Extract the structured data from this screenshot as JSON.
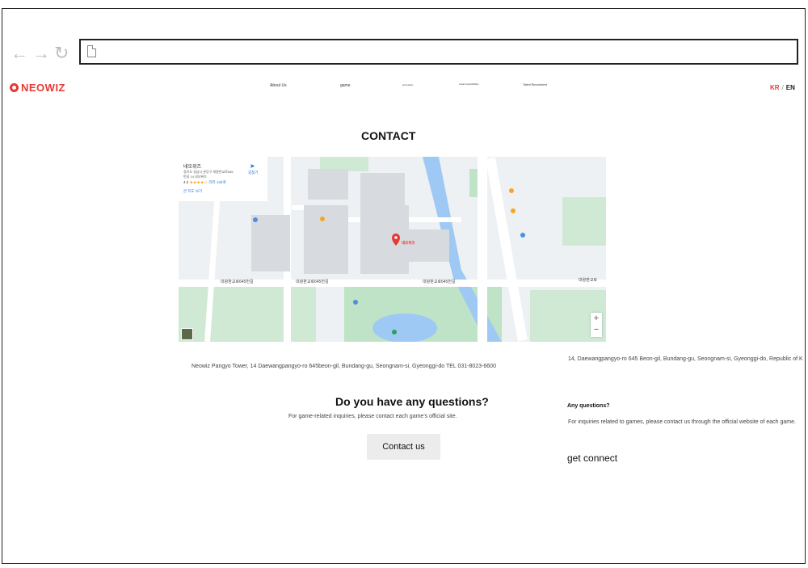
{
  "header": {
    "logo_text": "NEOWIZ",
    "menu": [
      "About Us",
      "game",
      "promotion",
      "social responsibilities",
      "Talent Recruitment"
    ],
    "lang": {
      "kr": "KR",
      "sep": "/",
      "en": "EN"
    }
  },
  "contact": {
    "title": "CONTACT",
    "address": "Neowiz Pangyo Tower, 14 Daewangpangyo-ro 645beon-gil, Bundang-gu, Seongnam-si, Gyeonggi-do TEL 031-8023-6600",
    "address_alt": "14, Daewangpangyo-ro 645 Beon-gil, Bundang-gu, Seongnam-si, Gyeonggi-do, Republic of K"
  },
  "map": {
    "place_name": "네오위즈",
    "place_address_1": "경기도 성남시 분당구 대왕판교로645",
    "place_address_2": "번길 14 네오위즈",
    "rating": "4.2",
    "reviews": "리뷰 130개",
    "larger_map": "큰 지도 보기",
    "directions": "길찾기",
    "marker_label": "네오위즈",
    "road_1": "대왕판교로645번길",
    "road_2": "대왕판교로645번길",
    "road_3": "대왕판교로645번길",
    "road_4": "대왕판교로"
  },
  "questions": {
    "title": "Do you have any questions?",
    "description": "For game-related inquiries, please contact each game's official site.",
    "button": "Contact us",
    "title_alt": "Any questions?",
    "description_alt": "For inquiries related to games, please contact us through the official website of each game.",
    "connect": "get connect"
  },
  "colors": {
    "brand": "#e53935",
    "button_bg": "#ececec",
    "map_green": "#bfe3c6",
    "map_water": "#9ec9f5"
  },
  "icons": [
    "back-arrow-icon",
    "forward-arrow-icon",
    "reload-icon",
    "page-icon",
    "map-pin-icon",
    "zoom-in-icon",
    "zoom-out-icon"
  ]
}
